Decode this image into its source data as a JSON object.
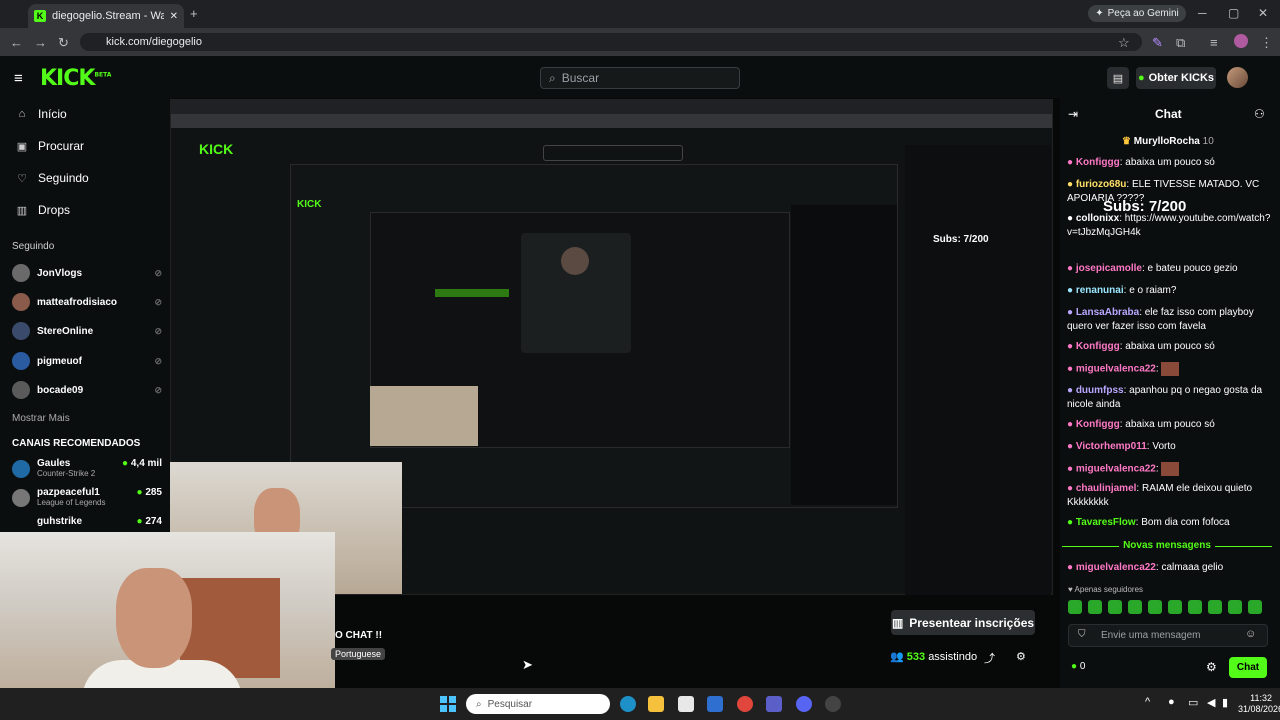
{
  "browser": {
    "tab_title": "diegogelio.Stream - Watch",
    "url": "kick.com/diegogelio",
    "gemini_label": "Peça ao Gemini"
  },
  "header": {
    "logo": "KICK",
    "logo_badge": "BETA",
    "search_placeholder": "Buscar",
    "obter_label": "Obter KICKs"
  },
  "sidebar": {
    "nav": [
      {
        "label": "Início",
        "icon": "home-icon"
      },
      {
        "label": "Procurar",
        "icon": "browse-icon"
      },
      {
        "label": "Seguindo",
        "icon": "heart-icon"
      },
      {
        "label": "Drops",
        "icon": "gift-icon"
      }
    ],
    "following_title": "Seguindo",
    "following": [
      "JonVlogs",
      "matteafrodisiaco",
      "StereOnline",
      "pigmeuof",
      "bocade09"
    ],
    "show_more": "Mostrar Mais",
    "recommended_title": "CANAIS RECOMENDADOS",
    "recommended": [
      {
        "name": "Gaules",
        "game": "Counter-Strike 2",
        "viewers": "4,4 mil"
      },
      {
        "name": "pazpeaceful1",
        "game": "League of Legends",
        "viewers": "285"
      },
      {
        "name": "guhstrike",
        "game": "",
        "viewers": "274"
      }
    ]
  },
  "stream": {
    "gift_label": "Presentear inscrições",
    "viewers": "533",
    "viewers_label": "assistindo",
    "overlay_text": "O CHAT !!",
    "lang_badge": "Portuguese"
  },
  "chat": {
    "title": "Chat",
    "pinned_user": "MurylloRocha",
    "pinned_count": "10",
    "subs_overlay": "Subs: 7/200",
    "messages": [
      {
        "user": "Konfiggg",
        "text": "abaixa um pouco só",
        "color": "#ff79c6"
      },
      {
        "user": "furiozo68u",
        "text": "ELE TIVESSE MATADO. VC APOIARIA ?????",
        "color": "#ffe066"
      },
      {
        "user": "collonixx",
        "text": "https://www.youtube.com/watch?v=tJbzMqJGH4k",
        "color": "#ffffff"
      },
      {
        "user": "josepicamolle",
        "text": "e bateu pouco gezio",
        "color": "#ff79c6"
      },
      {
        "user": "renanunai",
        "text": "e o raiam?",
        "color": "#9be7ff"
      },
      {
        "user": "LansaAbraba",
        "text": "ele faz isso com playboy quero ver fazer isso com favela",
        "color": "#b9a7ff"
      },
      {
        "user": "Konfiggg",
        "text": "abaixa um pouco só",
        "color": "#ff79c6"
      },
      {
        "user": "miguelvalenca22",
        "text": "",
        "color": "#ff79c6"
      },
      {
        "user": "duumfpss",
        "text": "apanhou pq o negao gosta da nicole ainda",
        "color": "#b9a7ff"
      },
      {
        "user": "Konfiggg",
        "text": "abaixa um pouco só",
        "color": "#ff79c6"
      },
      {
        "user": "Victorhemp011",
        "text": "Vorto",
        "color": "#ff79c6"
      },
      {
        "user": "miguelvalenca22",
        "text": "",
        "color": "#ff79c6"
      },
      {
        "user": "chaulinjamel",
        "text": "RAIAM ele deixou quieto Kkkkkkkk",
        "color": "#ff79c6"
      },
      {
        "user": "TavaresFlow",
        "text": "Bom dia com fofoca",
        "color": "#53fc18"
      }
    ],
    "new_messages": "Novas mensagens",
    "last_message": {
      "user": "miguelvalenca22",
      "text": "calmaaa gelio",
      "color": "#ff79c6"
    },
    "followers_only": "Apenas seguidores",
    "input_placeholder": "Envie uma mensagem",
    "kicks": "0",
    "chat_button": "Chat"
  },
  "taskbar": {
    "search_placeholder": "Pesquisar",
    "time": "11:32",
    "date": "31/08/2026"
  }
}
